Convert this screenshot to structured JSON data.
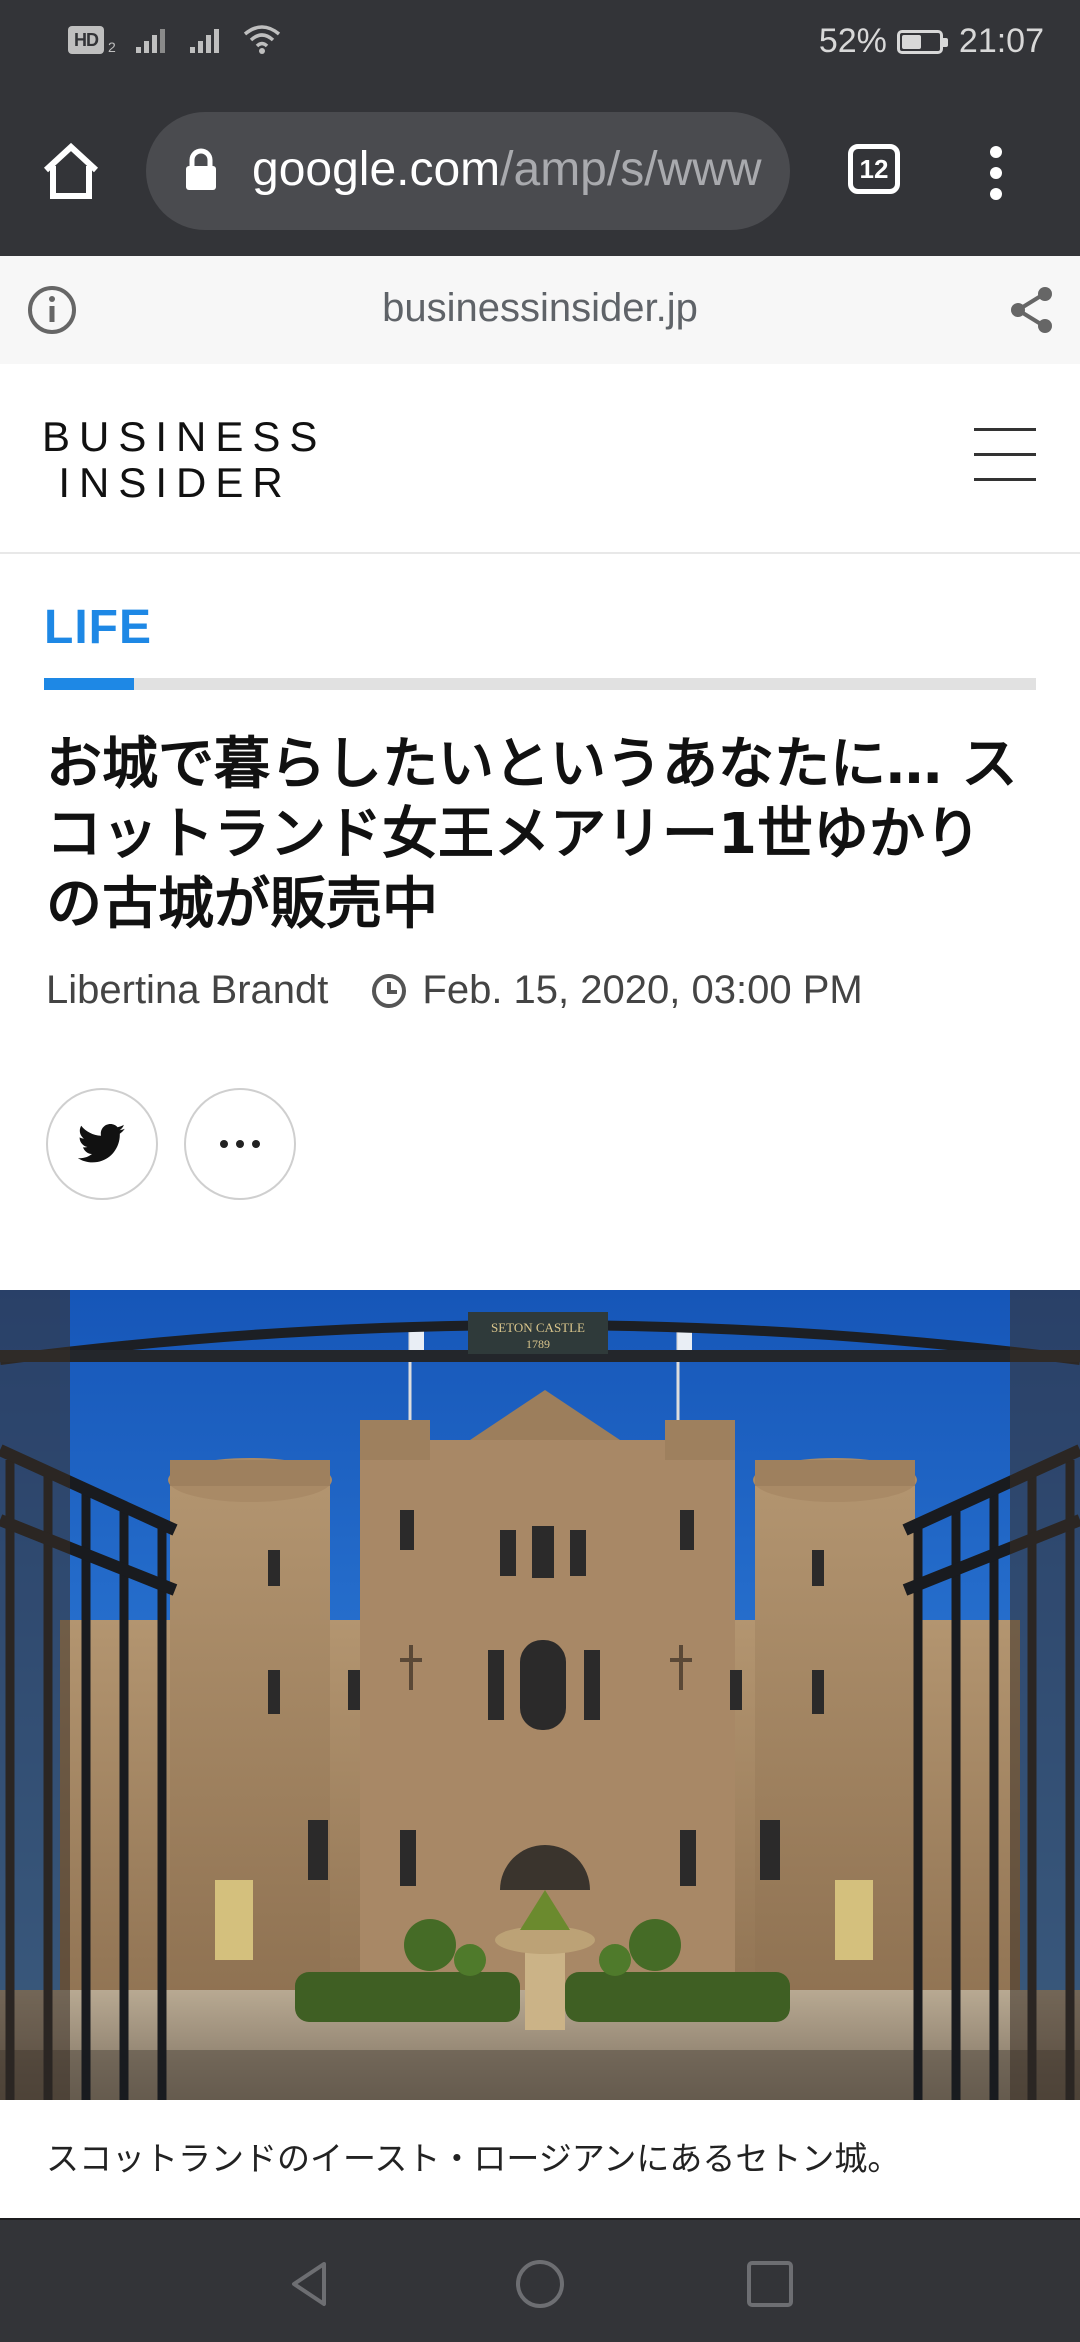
{
  "status_bar": {
    "hd_label": "HD",
    "hd_sub": "2",
    "battery_percent": "52%",
    "battery_level": 0.52,
    "time": "21:07"
  },
  "browser": {
    "url_host": "google.com",
    "url_path": "/amp/s/www",
    "tab_count": "12"
  },
  "amp_header": {
    "domain": "businessinsider.jp"
  },
  "site": {
    "logo_line1": "BUSINESS",
    "logo_line2": "INSIDER"
  },
  "article": {
    "section": "LIFE",
    "title": "お城で暮らしたいというあなたに… スコットランド女王メアリー1世ゆかりの古城が販売中",
    "author": "Libertina Brandt",
    "date": "Feb. 15, 2020, 03:00 PM",
    "image_caption": "スコットランドのイースト・ロージアンにあるセトン城。",
    "sign_text": "SETON CASTLE",
    "sign_year": "1789"
  },
  "colors": {
    "accent": "#1e88e5",
    "chrome": "#333438",
    "sky": "#1f6fd0",
    "stone": "#a88a64"
  },
  "icons": {
    "home": "home-icon",
    "lock": "lock-icon",
    "info": "info-icon",
    "share": "share-icon",
    "menu": "hamburger-menu-icon",
    "clock": "clock-icon",
    "twitter": "twitter-icon",
    "more": "more-horizontal-icon"
  }
}
